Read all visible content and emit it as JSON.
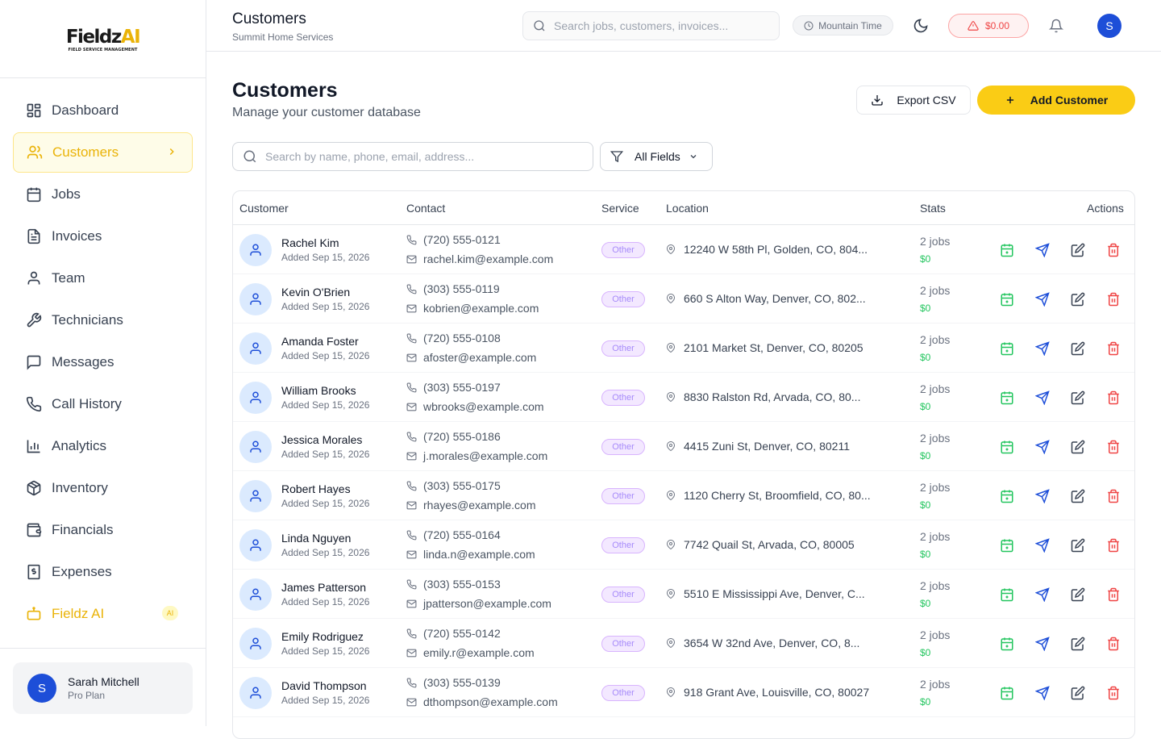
{
  "brand": {
    "logo_main": "Fieldz",
    "logo_ai": "AI",
    "logo_sub": "FIELD SERVICE MANAGEMENT"
  },
  "sidebar": {
    "items": [
      {
        "label": "Dashboard",
        "icon": "dashboard-icon"
      },
      {
        "label": "Customers",
        "icon": "users-icon",
        "active": true
      },
      {
        "label": "Jobs",
        "icon": "calendar-icon"
      },
      {
        "label": "Invoices",
        "icon": "file-text-icon"
      },
      {
        "label": "Team",
        "icon": "user-icon"
      },
      {
        "label": "Technicians",
        "icon": "wrench-icon"
      },
      {
        "label": "Messages",
        "icon": "message-icon"
      },
      {
        "label": "Call History",
        "icon": "phone-icon"
      },
      {
        "label": "Analytics",
        "icon": "bar-chart-icon"
      },
      {
        "label": "Inventory",
        "icon": "box-icon"
      },
      {
        "label": "Financials",
        "icon": "wallet-icon"
      },
      {
        "label": "Expenses",
        "icon": "receipt-icon"
      },
      {
        "label": "Fieldz AI",
        "icon": "bot-icon",
        "badge": "AI"
      }
    ],
    "user": {
      "initial": "S",
      "name": "Sarah Mitchell",
      "plan": "Pro Plan"
    }
  },
  "topbar": {
    "title": "Customers",
    "subtitle": "Summit Home Services",
    "search_placeholder": "Search jobs, customers, invoices...",
    "timezone": "Mountain Time",
    "balance": "$0.00",
    "avatar_initial": "S",
    "colors": {
      "accent": "#facc15",
      "brand_blue": "#1d4ed8",
      "alert_red": "#ef4444"
    }
  },
  "page": {
    "title": "Customers",
    "subtitle": "Manage your customer database",
    "export_label": "Export CSV",
    "add_label": "Add Customer",
    "search_placeholder": "Search by name, phone, email, address...",
    "filter_label": "All Fields"
  },
  "table": {
    "headers": {
      "customer": "Customer",
      "contact": "Contact",
      "service": "Service",
      "location": "Location",
      "stats": "Stats",
      "actions": "Actions"
    },
    "rows": [
      {
        "name": "Rachel Kim",
        "added": "Added Sep 15, 2026",
        "phone": "(720) 555-0121",
        "email": "rachel.kim@example.com",
        "service": "Other",
        "location": "12240 W 58th Pl, Golden, CO, 804...",
        "jobs": "2 jobs",
        "revenue": "$0"
      },
      {
        "name": "Kevin O'Brien",
        "added": "Added Sep 15, 2026",
        "phone": "(303) 555-0119",
        "email": "kobrien@example.com",
        "service": "Other",
        "location": "660 S Alton Way, Denver, CO, 802...",
        "jobs": "2 jobs",
        "revenue": "$0"
      },
      {
        "name": "Amanda Foster",
        "added": "Added Sep 15, 2026",
        "phone": "(720) 555-0108",
        "email": "afoster@example.com",
        "service": "Other",
        "location": "2101 Market St, Denver, CO, 80205",
        "jobs": "2 jobs",
        "revenue": "$0"
      },
      {
        "name": "William Brooks",
        "added": "Added Sep 15, 2026",
        "phone": "(303) 555-0197",
        "email": "wbrooks@example.com",
        "service": "Other",
        "location": "8830 Ralston Rd, Arvada, CO, 80...",
        "jobs": "2 jobs",
        "revenue": "$0"
      },
      {
        "name": "Jessica Morales",
        "added": "Added Sep 15, 2026",
        "phone": "(720) 555-0186",
        "email": "j.morales@example.com",
        "service": "Other",
        "location": "4415 Zuni St, Denver, CO, 80211",
        "jobs": "2 jobs",
        "revenue": "$0"
      },
      {
        "name": "Robert Hayes",
        "added": "Added Sep 15, 2026",
        "phone": "(303) 555-0175",
        "email": "rhayes@example.com",
        "service": "Other",
        "location": "1120 Cherry St, Broomfield, CO, 80...",
        "jobs": "2 jobs",
        "revenue": "$0"
      },
      {
        "name": "Linda Nguyen",
        "added": "Added Sep 15, 2026",
        "phone": "(720) 555-0164",
        "email": "linda.n@example.com",
        "service": "Other",
        "location": "7742 Quail St, Arvada, CO, 80005",
        "jobs": "2 jobs",
        "revenue": "$0"
      },
      {
        "name": "James Patterson",
        "added": "Added Sep 15, 2026",
        "phone": "(303) 555-0153",
        "email": "jpatterson@example.com",
        "service": "Other",
        "location": "5510 E Mississippi Ave, Denver, C...",
        "jobs": "2 jobs",
        "revenue": "$0"
      },
      {
        "name": "Emily Rodriguez",
        "added": "Added Sep 15, 2026",
        "phone": "(720) 555-0142",
        "email": "emily.r@example.com",
        "service": "Other",
        "location": "3654 W 32nd Ave, Denver, CO, 8...",
        "jobs": "2 jobs",
        "revenue": "$0"
      },
      {
        "name": "David Thompson",
        "added": "Added Sep 15, 2026",
        "phone": "(303) 555-0139",
        "email": "dthompson@example.com",
        "service": "Other",
        "location": "918 Grant Ave, Louisville, CO, 80027",
        "jobs": "2 jobs",
        "revenue": "$0"
      }
    ]
  }
}
